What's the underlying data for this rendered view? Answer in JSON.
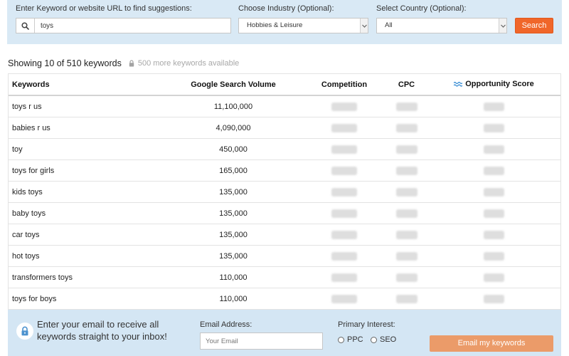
{
  "search": {
    "keyword_label": "Enter Keyword or website URL to find suggestions:",
    "keyword_value": "toys",
    "industry_label": "Choose Industry (Optional):",
    "industry_value": "Hobbies & Leisure",
    "country_label": "Select Country (Optional):",
    "country_value": "All",
    "search_button": "Search"
  },
  "summary": {
    "showing_text": "Showing 10 of 510 keywords",
    "more_text": "500 more keywords available"
  },
  "table": {
    "headers": {
      "keyword": "Keywords",
      "volume": "Google Search Volume",
      "competition": "Competition",
      "cpc": "CPC",
      "opportunity": "Opportunity Score"
    },
    "rows": [
      {
        "keyword": "toys r us",
        "volume": "11,100,000"
      },
      {
        "keyword": "babies r us",
        "volume": "4,090,000"
      },
      {
        "keyword": "toy",
        "volume": "450,000"
      },
      {
        "keyword": "toys for girls",
        "volume": "165,000"
      },
      {
        "keyword": "kids toys",
        "volume": "135,000"
      },
      {
        "keyword": "baby toys",
        "volume": "135,000"
      },
      {
        "keyword": "car toys",
        "volume": "135,000"
      },
      {
        "keyword": "hot toys",
        "volume": "135,000"
      },
      {
        "keyword": "transformers toys",
        "volume": "110,000"
      },
      {
        "keyword": "toys for boys",
        "volume": "110,000"
      }
    ]
  },
  "signup": {
    "message_line1": "Enter your email to receive all",
    "message_line2": "keywords straight to your inbox!",
    "email_label": "Email Address:",
    "email_placeholder": "Your Email",
    "interest_label": "Primary Interest:",
    "interest_options": [
      {
        "label": "PPC",
        "selected": false
      },
      {
        "label": "SEO",
        "selected": false
      }
    ],
    "submit_button": "Email my keywords"
  },
  "icons": {
    "search": "search-icon",
    "select_arrow": "chevron-down-icon",
    "locked": "lock-icon",
    "opportunity": "wave-icon"
  },
  "colors": {
    "panel_background": "#d9e9f5",
    "search_button": "#f0662a",
    "email_button": "#eb9b69",
    "opportunity_icon": "#3a8ed4",
    "lock_icon": "#4d93cf"
  }
}
